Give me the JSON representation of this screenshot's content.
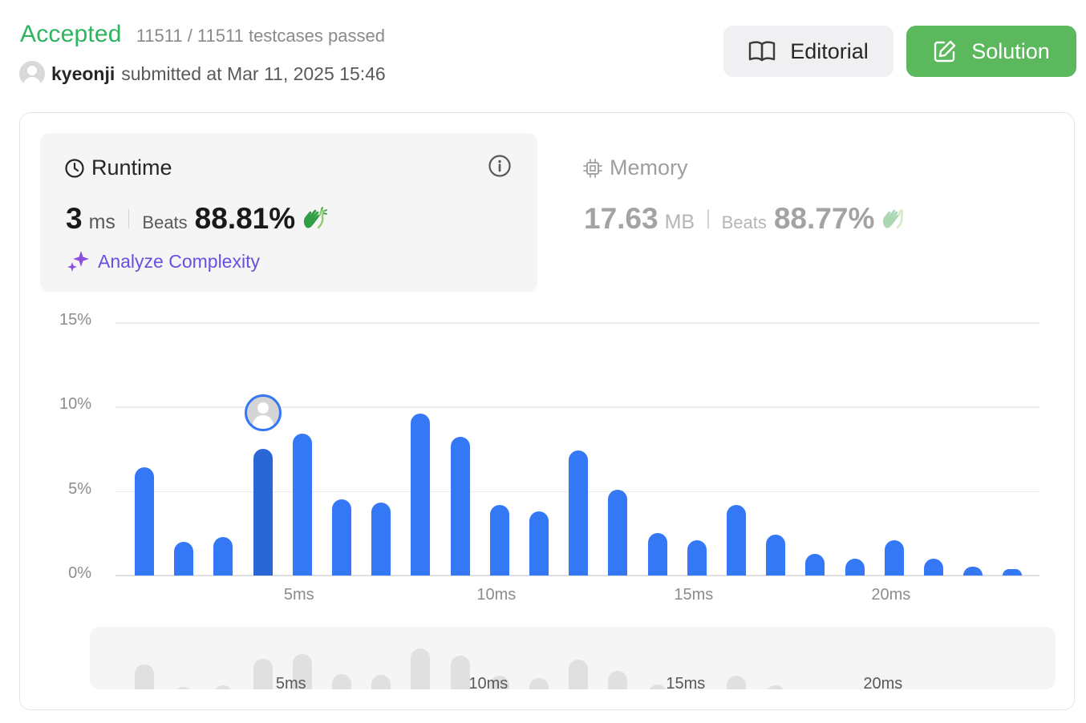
{
  "header": {
    "status": "Accepted",
    "testcases": "11511 / 11511 testcases passed",
    "username": "kyeonji",
    "submitted": "submitted at Mar 11, 2025 15:46"
  },
  "buttons": {
    "editorial": "Editorial",
    "solution": "Solution"
  },
  "runtime": {
    "title": "Runtime",
    "value": "3",
    "unit": "ms",
    "beats_label": "Beats",
    "beats": "88.81%",
    "analyze": "Analyze Complexity"
  },
  "memory": {
    "title": "Memory",
    "value": "17.63",
    "unit": "MB",
    "beats_label": "Beats",
    "beats": "88.77%"
  },
  "colors": {
    "accepted": "#2db55d",
    "solution_button": "#5cb85c",
    "bar": "#3478f6",
    "selected_bar": "#2a66d6",
    "analyze": "#6b4fe0"
  },
  "icons": {
    "editorial": "book-icon",
    "solution": "edit-icon",
    "runtime": "clock-icon",
    "memory": "chip-icon",
    "info": "info-icon",
    "clap": "clap-icon",
    "analyze": "sparkle-icon"
  },
  "chart_data": {
    "type": "bar",
    "x": [
      1,
      2,
      3,
      4,
      5,
      6,
      7,
      8,
      9,
      10,
      11,
      12,
      13,
      14,
      15,
      16,
      17,
      18,
      19,
      20,
      21,
      22,
      23
    ],
    "values": [
      6.4,
      2.0,
      2.3,
      7.5,
      8.4,
      4.5,
      4.3,
      9.6,
      8.2,
      4.2,
      3.8,
      7.4,
      5.1,
      2.5,
      2.1,
      4.2,
      2.4,
      1.3,
      1.0,
      2.1,
      1.0,
      0.5,
      0.4
    ],
    "selected_x": 4,
    "ylim": [
      0,
      15
    ],
    "y_ticks": [
      "0%",
      "5%",
      "10%",
      "15%"
    ],
    "x_ticks": [
      "5ms",
      "10ms",
      "15ms",
      "20ms"
    ],
    "x_tick_values": [
      5,
      10,
      15,
      20
    ],
    "grid": true,
    "minimap_x_ticks": [
      "5ms",
      "10ms",
      "15ms",
      "20ms"
    ]
  }
}
